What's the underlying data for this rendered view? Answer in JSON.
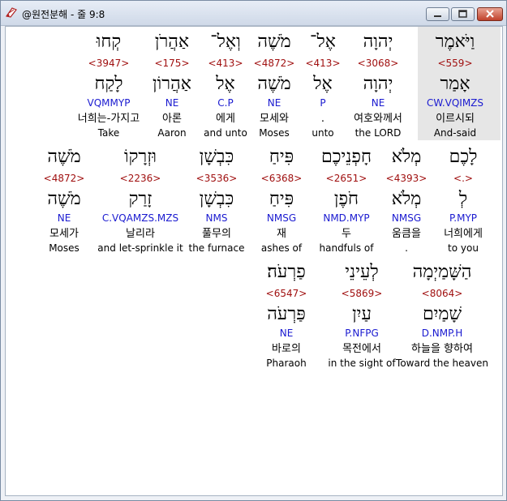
{
  "window": {
    "title": "@원전분해 - 줄 9:8"
  },
  "rows": [
    {
      "words": [
        {
          "heb": "וַיֹּאמֶר",
          "strong": "<559>",
          "lemma": "אָמַר",
          "morph": "CW.VQIMZS",
          "kor": "이르시되",
          "eng": "And-said",
          "highlighted": true
        },
        {
          "heb": "יְהוָה",
          "strong": "<3068>",
          "lemma": "יְהוָה",
          "morph": "NE",
          "kor": "여호와께서",
          "eng": "the LORD"
        },
        {
          "heb": "אֶל־",
          "strong": "<413>",
          "lemma": "אֶל",
          "morph": "P",
          "kor": ".",
          "eng": "unto"
        },
        {
          "heb": "מֹשֶׁה",
          "strong": "<4872>",
          "lemma": "מֹשֶׁה",
          "morph": "NE",
          "kor": "모세와",
          "eng": "Moses"
        },
        {
          "heb": "וְאֶל־",
          "strong": "<413>",
          "lemma": "אֶל",
          "morph": "C.P",
          "kor": "에게",
          "eng": "and unto"
        },
        {
          "heb": "אַהֲרֹן",
          "strong": "<175>",
          "lemma": "אַהֲרוֹן",
          "morph": "NE",
          "kor": "아론",
          "eng": "Aaron"
        },
        {
          "heb": "קְחוּ",
          "strong": "<3947>",
          "lemma": "לָקַח",
          "morph": "VQMMYP",
          "kor": "너희는-가지고",
          "eng": "Take"
        }
      ]
    },
    {
      "words": [
        {
          "heb": "לָכֶם",
          "strong": "<.>",
          "lemma": "לְ",
          "morph": "P.MYP",
          "kor": "너희에게",
          "eng": "to you"
        },
        {
          "heb": "מְלֹא",
          "strong": "<4393>",
          "lemma": "מְלֹא",
          "morph": "NMSG",
          "kor": "움큼을",
          "eng": "."
        },
        {
          "heb": "חָפְנֵיכֶם",
          "strong": "<2651>",
          "lemma": "חֹפֶן",
          "morph": "NMD.MYP",
          "kor": "두",
          "eng": "handfuls of"
        },
        {
          "heb": "פִּיחַ",
          "strong": "<6368>",
          "lemma": "פִּיחַ",
          "morph": "NMSG",
          "kor": "재",
          "eng": "ashes of"
        },
        {
          "heb": "כִּבְשָׁן",
          "strong": "<3536>",
          "lemma": "כִּבְשָׁן",
          "morph": "NMS",
          "kor": "풀무의",
          "eng": "the furnace"
        },
        {
          "heb": "וּזְרָקוֹ",
          "strong": "<2236>",
          "lemma": "זָרַק",
          "morph": "C.VQAMZS.MZS",
          "kor": "날리라",
          "eng": "and let-sprinkle it"
        },
        {
          "heb": "מֹשֶׁה",
          "strong": "<4872>",
          "lemma": "מֹשֶׁה",
          "morph": "NE",
          "kor": "모세가",
          "eng": "Moses"
        }
      ]
    },
    {
      "words": [
        {
          "heb": "הַשָּׁמַיְמָה",
          "strong": "<8064>",
          "lemma": "שָׁמַיִם",
          "morph": "D.NMP.H",
          "kor": "하늘을 향하여",
          "eng": "Toward the heaven"
        },
        {
          "heb": "לְעֵינֵי",
          "strong": "<5869>",
          "lemma": "עַיִן",
          "morph": "P.NFPG",
          "kor": "목전에서",
          "eng": "in the sight of"
        },
        {
          "heb": "פַרְעֹה׃",
          "strong": "<6547>",
          "lemma": "פַּרְעֹה",
          "morph": "NE",
          "kor": "바로의",
          "eng": "Pharaoh"
        }
      ]
    }
  ]
}
